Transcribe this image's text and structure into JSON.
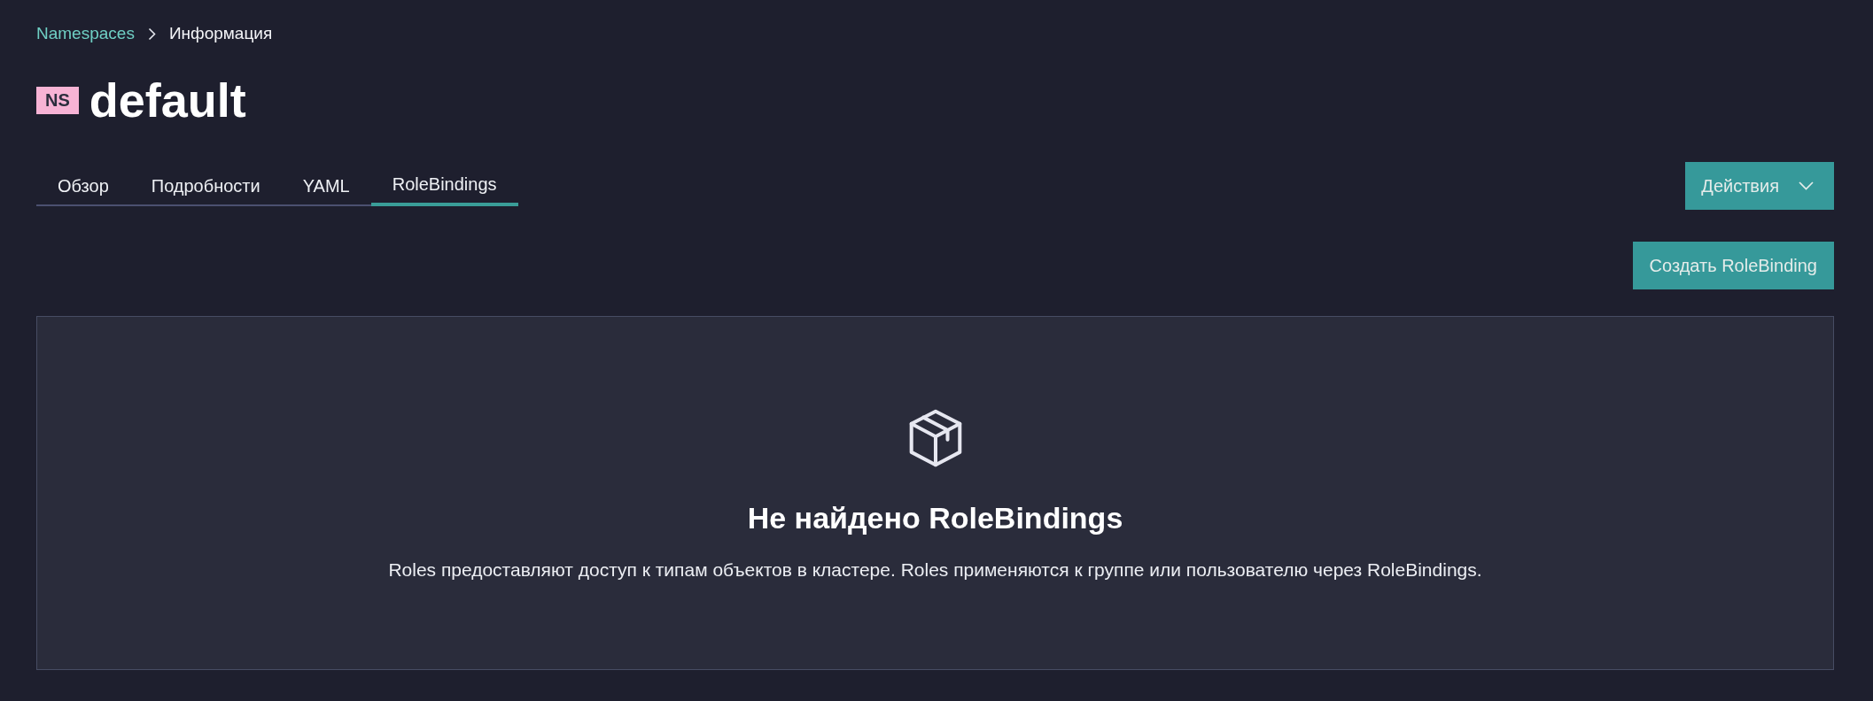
{
  "breadcrumb": [
    {
      "label": "Namespaces",
      "kind": "link"
    },
    {
      "label": "Информация",
      "kind": "current"
    }
  ],
  "heading": {
    "badge": "NS",
    "title": "default"
  },
  "tabs": [
    {
      "label": "Обзор",
      "selected": false
    },
    {
      "label": "Подробности",
      "selected": false
    },
    {
      "label": "YAML",
      "selected": false
    },
    {
      "label": "RoleBindings",
      "selected": true
    }
  ],
  "actions_menu": {
    "label": "Действия"
  },
  "create_button": {
    "label": "Создать RoleBinding"
  },
  "empty_state": {
    "title": "Не найдено RoleBindings",
    "description": "Roles предоставляют доступ к типам объектов в кластере. Roles применяются к группе или пользователю через RoleBindings."
  }
}
